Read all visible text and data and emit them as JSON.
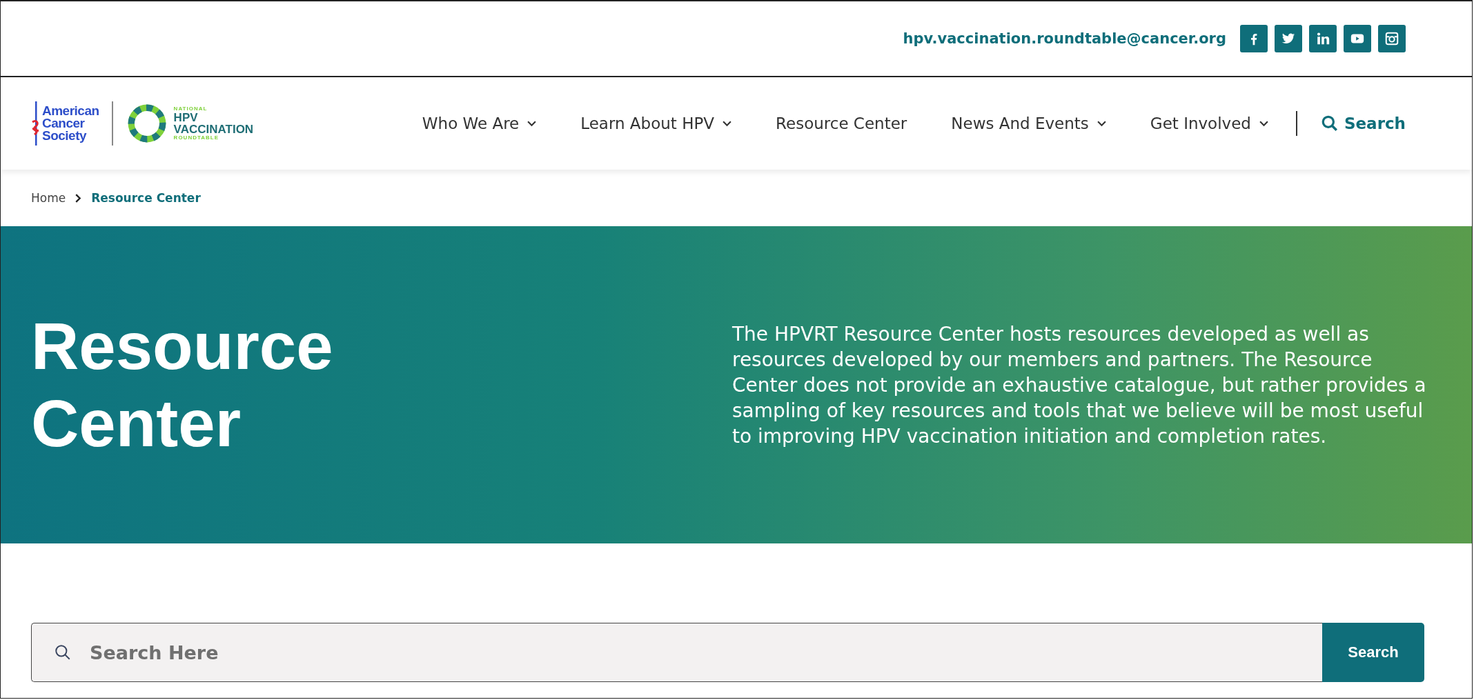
{
  "top_bar": {
    "email": "hpv.vaccination.roundtable@cancer.org",
    "social": [
      {
        "kind": "facebook"
      },
      {
        "kind": "twitter"
      },
      {
        "kind": "linkedin"
      },
      {
        "kind": "youtube"
      },
      {
        "kind": "instagram"
      }
    ]
  },
  "header": {
    "logo_left": [
      "American",
      "Cancer",
      "Society"
    ],
    "logo_right": {
      "top": "NATIONAL",
      "main": [
        "HPV",
        "VACCINATION"
      ],
      "bottom": "ROUNDTABLE"
    },
    "nav": [
      {
        "label": "Who We Are",
        "dropdown": true
      },
      {
        "label": "Learn About HPV",
        "dropdown": true
      },
      {
        "label": "Resource Center",
        "dropdown": false
      },
      {
        "label": "News And Events",
        "dropdown": true
      },
      {
        "label": "Get Involved",
        "dropdown": true
      }
    ],
    "search_link": "Search"
  },
  "breadcrumb": [
    {
      "label": "Home",
      "current": false
    },
    {
      "label": "Resource Center",
      "current": true
    }
  ],
  "hero": {
    "title": "Resource Center",
    "description": "The HPVRT Resource Center hosts resources developed as well as resources developed by our members and partners. The Resource Center does not provide an exhaustive catalogue, but rather provides a sampling of key resources and tools that we believe will be most useful to improving HPV vaccination initiation and completion rates."
  },
  "search": {
    "placeholder": "Search Here",
    "button": "Search"
  }
}
